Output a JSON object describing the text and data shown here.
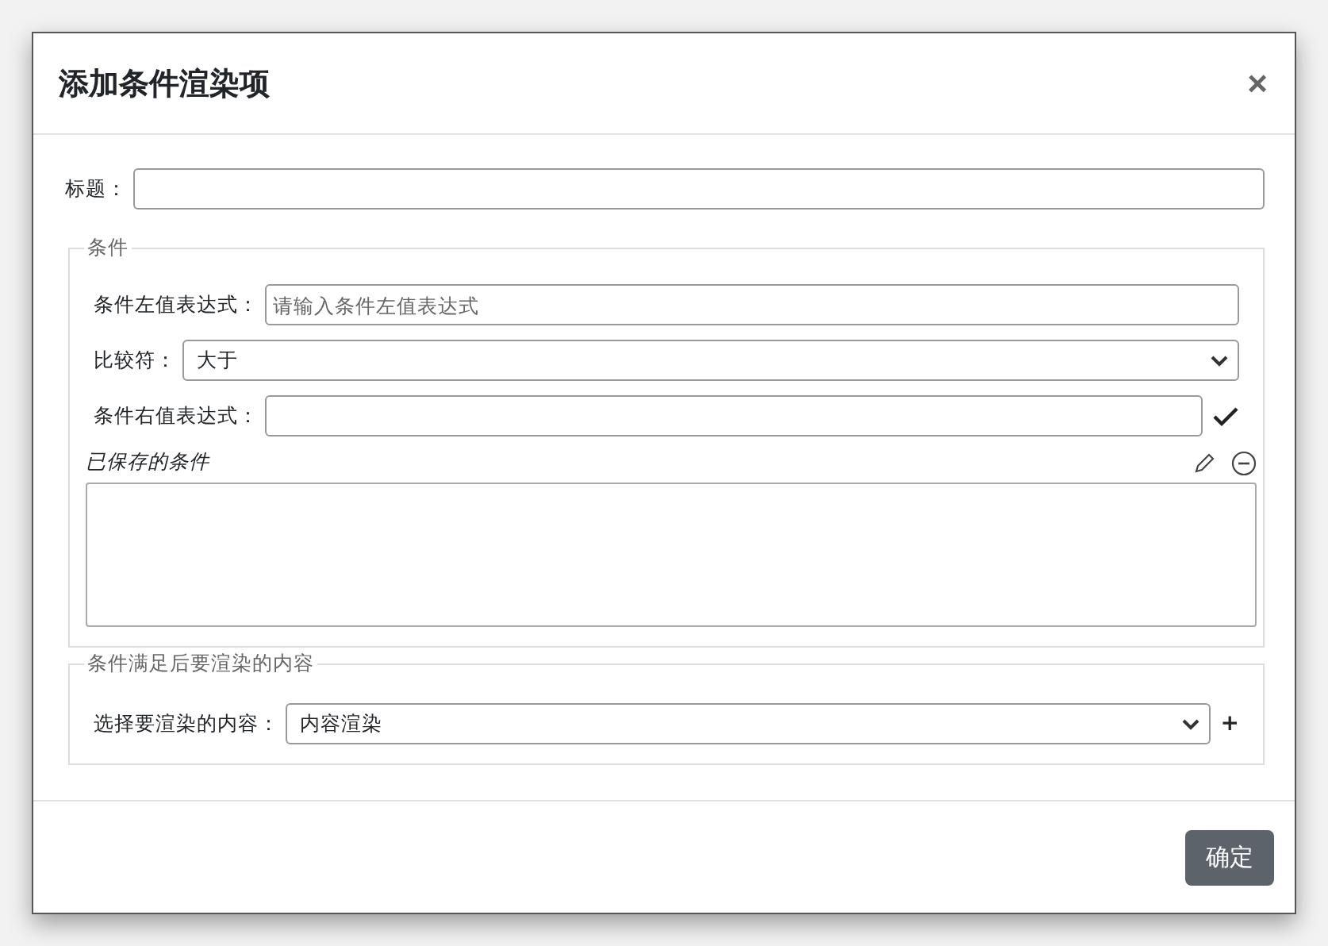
{
  "dialog": {
    "title": "添加条件渲染项",
    "close": "×"
  },
  "title_field": {
    "label": "标题："
  },
  "condition": {
    "legend": "条件",
    "left": {
      "label": "条件左值表达式：",
      "placeholder": "请输入条件左值表达式"
    },
    "comparator": {
      "label": "比较符：",
      "value": "大于"
    },
    "right": {
      "label": "条件右值表达式："
    },
    "saved": {
      "label": "已保存的条件"
    }
  },
  "render": {
    "legend": "条件满足后要渲染的内容",
    "select": {
      "label": "选择要渲染的内容：",
      "value": "内容渲染"
    },
    "add": "+"
  },
  "buttons": [
    {
      "label": "确定"
    }
  ]
}
